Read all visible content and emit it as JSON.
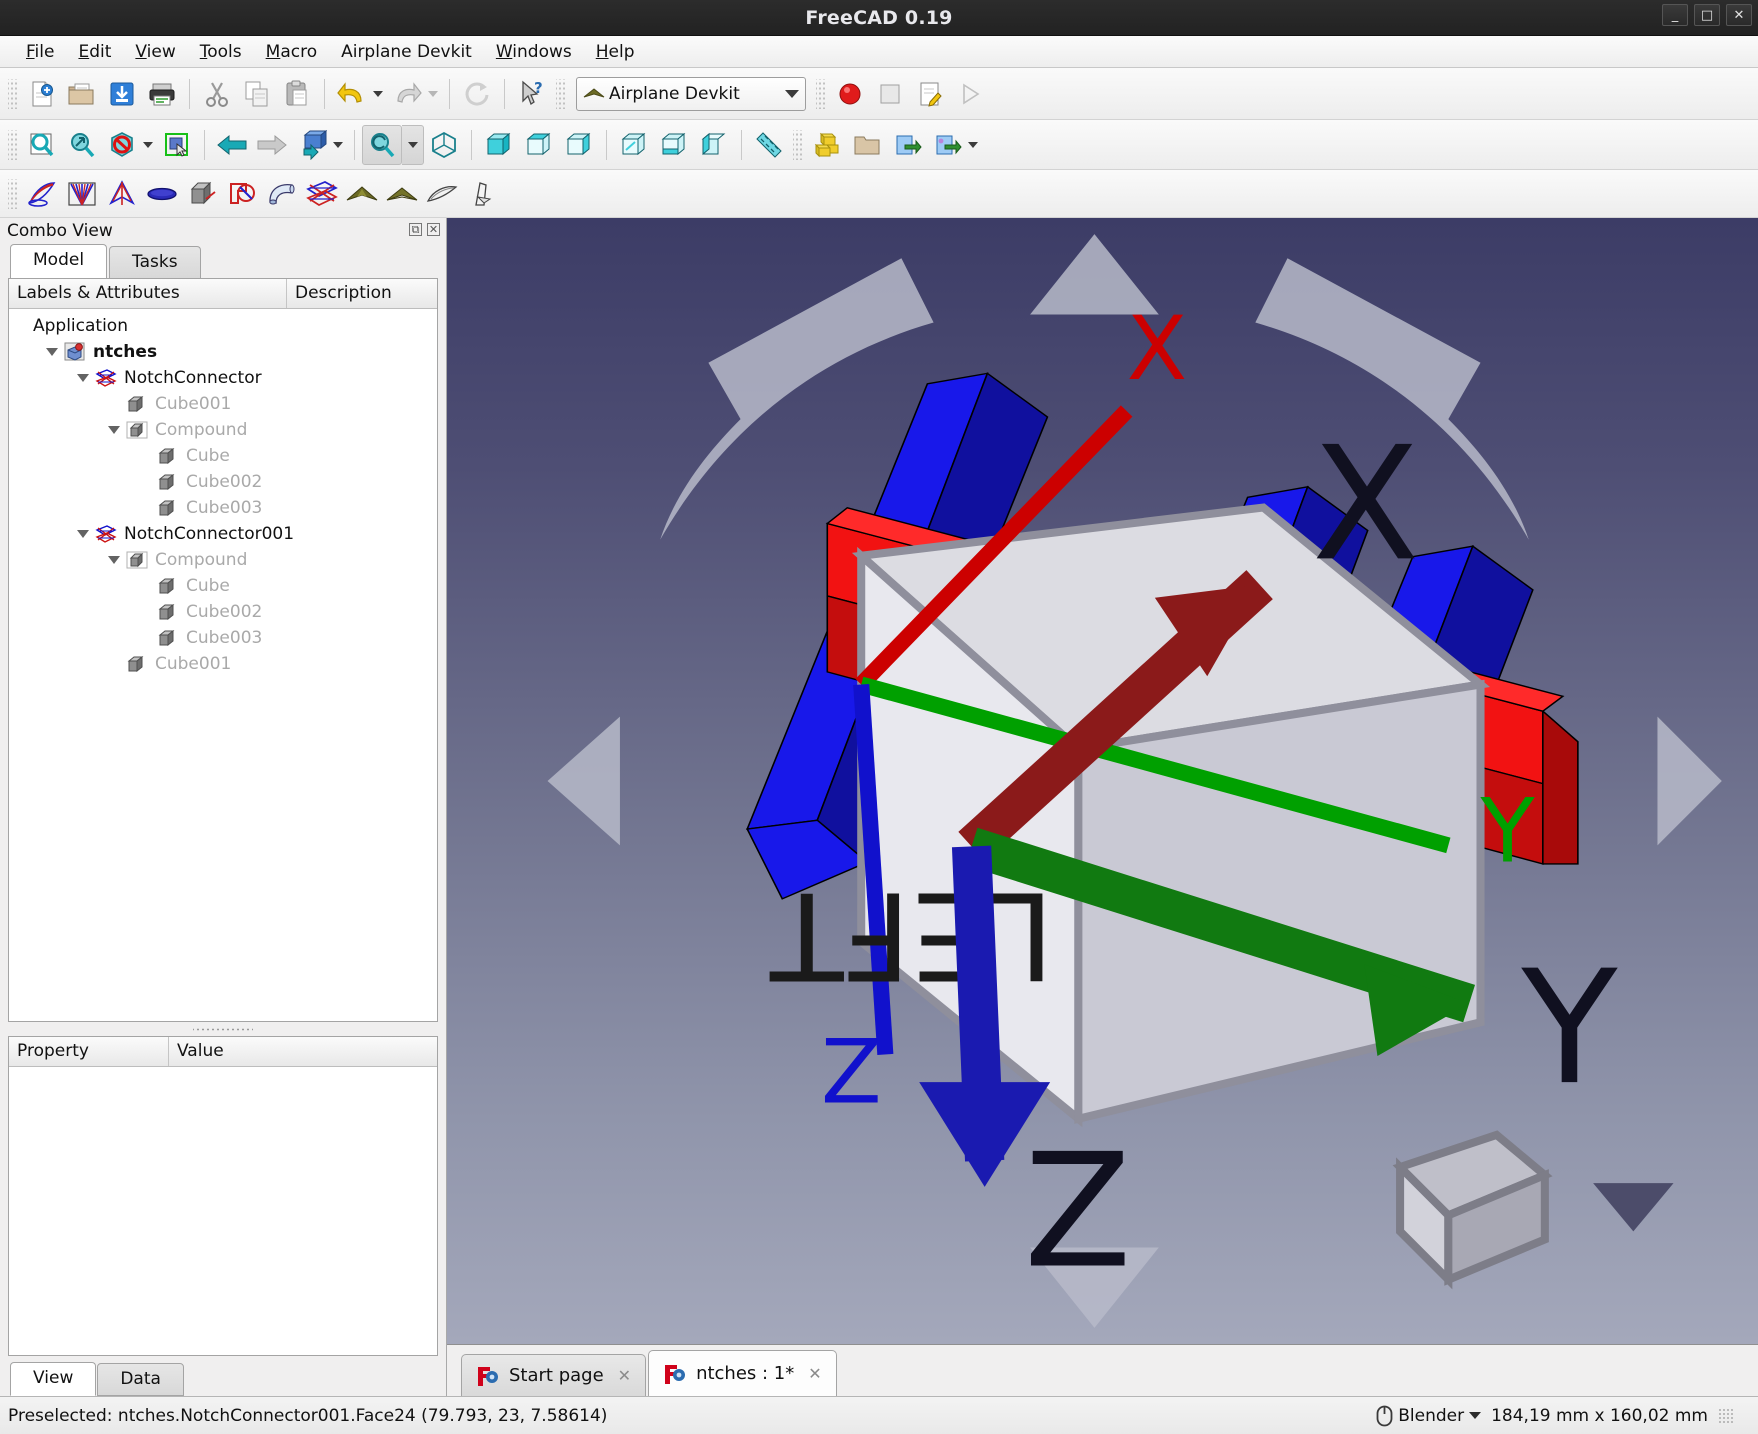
{
  "window": {
    "title": "FreeCAD 0.19",
    "controls": {
      "minimize": "_",
      "maximize": "□",
      "close": "✕"
    }
  },
  "menubar": {
    "items": [
      {
        "label": "File",
        "mnemonic": "F"
      },
      {
        "label": "Edit",
        "mnemonic": "E"
      },
      {
        "label": "View",
        "mnemonic": "V"
      },
      {
        "label": "Tools",
        "mnemonic": "T"
      },
      {
        "label": "Macro",
        "mnemonic": "M"
      },
      {
        "label": "Airplane Devkit",
        "mnemonic": ""
      },
      {
        "label": "Windows",
        "mnemonic": "W"
      },
      {
        "label": "Help",
        "mnemonic": "H"
      }
    ]
  },
  "toolbars": {
    "file": [
      {
        "name": "new-document-icon",
        "tip": "New"
      },
      {
        "name": "open-document-icon",
        "tip": "Open"
      },
      {
        "name": "save-document-icon",
        "tip": "Save"
      },
      {
        "name": "print-icon",
        "tip": "Print"
      },
      {
        "name": "cut-icon",
        "tip": "Cut"
      },
      {
        "name": "copy-icon",
        "tip": "Copy"
      },
      {
        "name": "paste-icon",
        "tip": "Paste"
      },
      {
        "name": "undo-icon",
        "tip": "Undo"
      },
      {
        "name": "redo-icon",
        "tip": "Redo"
      },
      {
        "name": "refresh-icon",
        "tip": "Refresh"
      },
      {
        "name": "whats-this-icon",
        "tip": "What's This?"
      }
    ],
    "workbench": {
      "selected": "Airplane Devkit",
      "icon": "airplane-devkit-icon"
    },
    "macro": [
      {
        "name": "macro-record-icon",
        "tip": "Macro recording"
      },
      {
        "name": "macro-stop-icon",
        "tip": "Stop macro recording"
      },
      {
        "name": "macro-edit-icon",
        "tip": "Macros"
      },
      {
        "name": "macro-execute-icon",
        "tip": "Execute macro"
      }
    ],
    "view": [
      {
        "name": "fit-all-icon",
        "tip": "Fit all"
      },
      {
        "name": "fit-selection-icon",
        "tip": "Fit selection"
      },
      {
        "name": "draw-style-icon",
        "tip": "Draw style"
      },
      {
        "name": "select-box-icon",
        "tip": "Box selection"
      },
      {
        "name": "nav-back-icon",
        "tip": "Back"
      },
      {
        "name": "nav-forward-icon",
        "tip": "Forward"
      },
      {
        "name": "std-views-icon",
        "tip": "Standard views"
      },
      {
        "name": "axonometric-icon",
        "tip": "Isometric"
      },
      {
        "name": "view-front-icon",
        "tip": "Front"
      },
      {
        "name": "view-top-icon",
        "tip": "Top"
      },
      {
        "name": "view-right-icon",
        "tip": "Right"
      },
      {
        "name": "view-rear-icon",
        "tip": "Rear"
      },
      {
        "name": "view-bottom-icon",
        "tip": "Bottom"
      },
      {
        "name": "view-left-icon",
        "tip": "Left"
      },
      {
        "name": "measure-icon",
        "tip": "Measure"
      },
      {
        "name": "create-group-icon",
        "tip": "Create group"
      },
      {
        "name": "folder-icon",
        "tip": "Group"
      },
      {
        "name": "link-make-icon",
        "tip": "Make link"
      },
      {
        "name": "link-actions-icon",
        "tip": "Link actions"
      }
    ],
    "devkit": [
      {
        "name": "wing-icon",
        "tip": "Wing"
      },
      {
        "name": "rib-fan-icon",
        "tip": "Ribs"
      },
      {
        "name": "airfoil-icon",
        "tip": "Airfoil"
      },
      {
        "name": "ellipse-icon",
        "tip": "Ellipse"
      },
      {
        "name": "box-icon",
        "tip": "Box"
      },
      {
        "name": "notch-icon",
        "tip": "Notch"
      },
      {
        "name": "tube-icon",
        "tip": "Tube"
      },
      {
        "name": "notch-connector-icon",
        "tip": "Notch connector"
      },
      {
        "name": "airplane-top-icon",
        "tip": "Airplane"
      },
      {
        "name": "airplane-alt-icon",
        "tip": "Airplane alt"
      },
      {
        "name": "fuselage-icon",
        "tip": "Fuselage"
      },
      {
        "name": "tail-icon",
        "tip": "Tail"
      }
    ]
  },
  "combo_view": {
    "title": "Combo View",
    "dock_buttons": [
      "⧉",
      "✕"
    ],
    "tabs": [
      {
        "label": "Model",
        "selected": true
      },
      {
        "label": "Tasks",
        "selected": false
      }
    ],
    "tree_columns": [
      "Labels & Attributes",
      "Description"
    ],
    "tree": [
      {
        "label": "Application",
        "depth": 0,
        "twist": "none",
        "icon": "none",
        "style": "plain"
      },
      {
        "label": "ntches",
        "depth": 1,
        "twist": "open",
        "icon": "document-icon",
        "style": "bold"
      },
      {
        "label": "NotchConnector",
        "depth": 2,
        "twist": "open",
        "icon": "notch-connector-icon",
        "style": "plain"
      },
      {
        "label": "Cube001",
        "depth": 3,
        "twist": "none",
        "icon": "cube-icon",
        "style": "dim"
      },
      {
        "label": "Compound",
        "depth": 3,
        "twist": "open",
        "icon": "compound-icon",
        "style": "dim"
      },
      {
        "label": "Cube",
        "depth": 4,
        "twist": "none",
        "icon": "cube-icon",
        "style": "dim"
      },
      {
        "label": "Cube002",
        "depth": 4,
        "twist": "none",
        "icon": "cube-icon",
        "style": "dim"
      },
      {
        "label": "Cube003",
        "depth": 4,
        "twist": "none",
        "icon": "cube-icon",
        "style": "dim"
      },
      {
        "label": "NotchConnector001",
        "depth": 2,
        "twist": "open",
        "icon": "notch-connector-icon",
        "style": "plain"
      },
      {
        "label": "Compound",
        "depth": 3,
        "twist": "open",
        "icon": "compound-icon",
        "style": "dim"
      },
      {
        "label": "Cube",
        "depth": 4,
        "twist": "none",
        "icon": "cube-icon",
        "style": "dim"
      },
      {
        "label": "Cube002",
        "depth": 4,
        "twist": "none",
        "icon": "cube-icon",
        "style": "dim"
      },
      {
        "label": "Cube003",
        "depth": 4,
        "twist": "none",
        "icon": "cube-icon",
        "style": "dim"
      },
      {
        "label": "Cube001",
        "depth": 3,
        "twist": "none",
        "icon": "cube-icon",
        "style": "dim"
      }
    ],
    "property_columns": [
      "Property",
      "Value"
    ],
    "property_rows": [],
    "property_tabs": [
      {
        "label": "View",
        "selected": true
      },
      {
        "label": "Data",
        "selected": false
      }
    ]
  },
  "viewport": {
    "background_top": "#3c3c66",
    "background_bottom": "#a3a7ba",
    "navcube": {
      "face_label": "LEFT",
      "axes": [
        {
          "label": "X",
          "color": "#cc0000"
        },
        {
          "label": "Y",
          "color": "#00a000"
        },
        {
          "label": "Z",
          "color": "#1111cc"
        }
      ]
    },
    "axis_cross": [
      {
        "label": "X",
        "color": "#8b1a1a"
      },
      {
        "label": "Y",
        "color": "#117a11"
      },
      {
        "label": "Z",
        "color": "#1a1ab0"
      }
    ],
    "objects": {
      "blue_color": "#1414e6",
      "red_color": "#e01010"
    }
  },
  "doc_tabs": [
    {
      "label": "Start page",
      "selected": false,
      "close": "✕"
    },
    {
      "label": "ntches : 1*",
      "selected": true,
      "close": "✕"
    }
  ],
  "statusbar": {
    "message": "Preselected: ntches.NotchConnector001.Face24 (79.793, 23, 7.58614)",
    "navigation_style": "Blender",
    "dimensions": "184,19 mm x 160,02 mm"
  }
}
